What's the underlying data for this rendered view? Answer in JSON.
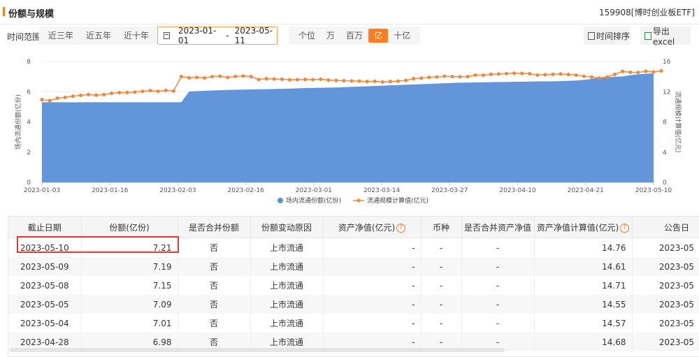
{
  "header": {
    "title": "份额与规模",
    "code": "159908[博时创业板ETF]"
  },
  "toolbar": {
    "range_label": "时间范围",
    "ranges": [
      "近三年",
      "近五年",
      "近十年"
    ],
    "date_start": "2023-01-01",
    "date_sep": "-",
    "date_end": "2023-05-11",
    "units": [
      "个位",
      "万",
      "百万",
      "亿",
      "十亿"
    ],
    "active_unit": "亿",
    "sort_label": "时间排序",
    "export_label": "导出excel"
  },
  "chart_data": {
    "type": "area",
    "x_ticks": [
      "2023-01-03",
      "2023-01-16",
      "2023-02-03",
      "2023-02-16",
      "2023-03-01",
      "2023-03-14",
      "2023-03-27",
      "2023-04-10",
      "2023-04-21",
      "2023-05-10"
    ],
    "ylabel_left": "场内流通份额(亿份)",
    "ylabel_right": "流通规模计算值(亿元)",
    "ylim_left": [
      0,
      8
    ],
    "yticks_left": [
      "0",
      "2",
      "4",
      "6",
      "8"
    ],
    "ylim_right": [
      0,
      16
    ],
    "yticks_right": [
      "0",
      "4",
      "8",
      "12",
      "16"
    ],
    "legend": [
      "场内流通份额(亿份)",
      "流通规模计算值(亿元)"
    ],
    "legend_position": "bottom",
    "series": [
      {
        "name": "场内流通份额(亿份)",
        "color": "#5b8fd8",
        "values": [
          5.3,
          5.3,
          5.3,
          5.3,
          5.3,
          5.3,
          5.3,
          5.3,
          5.3,
          5.3,
          5.3,
          5.3,
          5.3,
          5.3,
          5.3,
          5.3,
          5.3,
          5.3,
          5.3,
          6.02,
          6.04,
          6.06,
          6.08,
          6.1,
          6.12,
          6.13,
          6.14,
          6.15,
          6.16,
          6.17,
          6.18,
          6.19,
          6.2,
          6.22,
          6.24,
          6.25,
          6.26,
          6.27,
          6.28,
          6.3,
          6.32,
          6.34,
          6.36,
          6.38,
          6.4,
          6.42,
          6.44,
          6.46,
          6.48,
          6.5,
          6.52,
          6.54,
          6.56,
          6.58,
          6.6,
          6.6,
          6.61,
          6.62,
          6.63,
          6.64,
          6.65,
          6.66,
          6.66,
          6.67,
          6.68,
          6.68,
          6.69,
          6.7,
          6.72,
          6.74,
          6.78,
          6.85,
          6.93,
          6.96,
          6.98,
          7.01,
          7.09,
          7.15,
          7.19,
          7.21
        ]
      },
      {
        "name": "流通规模计算值(亿元)",
        "color": "#f0883c",
        "values": [
          10.95,
          10.82,
          11.15,
          11.25,
          11.4,
          11.52,
          11.62,
          11.55,
          11.62,
          11.78,
          11.88,
          11.9,
          11.95,
          12.05,
          12.15,
          12.05,
          12.18,
          12.1,
          14.0,
          13.85,
          13.9,
          13.82,
          14.0,
          14.05,
          13.9,
          14.02,
          14.08,
          14.0,
          13.62,
          13.72,
          13.68,
          13.65,
          13.58,
          13.6,
          13.62,
          13.6,
          13.65,
          13.55,
          13.5,
          13.45,
          13.42,
          13.4,
          13.35,
          13.38,
          13.28,
          13.35,
          13.4,
          13.5,
          13.72,
          13.8,
          13.9,
          13.95,
          14.05,
          14.0,
          13.98,
          14.0,
          14.2,
          14.18,
          14.3,
          14.35,
          14.4,
          14.45,
          14.42,
          14.38,
          14.2,
          14.25,
          14.3,
          14.35,
          14.28,
          14.2,
          14.05,
          13.95,
          13.8,
          13.95,
          14.3,
          14.68,
          14.57,
          14.55,
          14.71,
          14.61,
          14.76
        ]
      }
    ]
  },
  "table": {
    "headers": [
      "截止日期",
      "份额(亿份)",
      "是否合并份额",
      "份额变动原因",
      "资产净值(亿元)",
      "币种",
      "是否合并资产净值",
      "资产净值计算值(亿元)",
      "公告日"
    ],
    "rows": [
      [
        "2023-05-10",
        "7.21",
        "否",
        "上市流通",
        "-",
        "-",
        "-",
        "14.76",
        "2023-05"
      ],
      [
        "2023-05-09",
        "7.19",
        "否",
        "上市流通",
        "-",
        "-",
        "-",
        "14.61",
        "2023-05"
      ],
      [
        "2023-05-08",
        "7.15",
        "否",
        "上市流通",
        "-",
        "-",
        "-",
        "14.71",
        "2023-05"
      ],
      [
        "2023-05-05",
        "7.09",
        "否",
        "上市流通",
        "-",
        "-",
        "-",
        "14.55",
        "2023-05"
      ],
      [
        "2023-05-04",
        "7.01",
        "否",
        "上市流通",
        "-",
        "-",
        "-",
        "14.57",
        "2023-05"
      ],
      [
        "2023-04-28",
        "6.98",
        "否",
        "上市流通",
        "-",
        "-",
        "-",
        "14.68",
        "2023-05"
      ]
    ]
  },
  "colors": {
    "accent": "#ff7d1f",
    "area": "#5b8fd8",
    "line": "#f0883c",
    "highlight": "#e53935"
  }
}
